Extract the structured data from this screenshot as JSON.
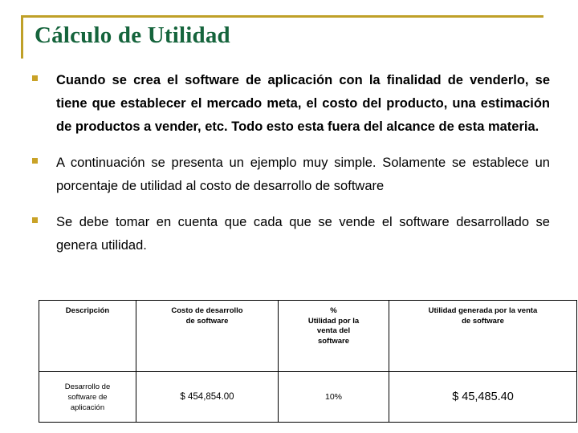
{
  "slide": {
    "title": "Cálculo de Utilidad",
    "accent_color": "#bfa028",
    "title_color": "#15643c",
    "bullet_color": "#c9a227",
    "background": "#ffffff"
  },
  "bullets": [
    {
      "marker": "square-bullet",
      "text": "Cuando se crea el software de aplicación con la finalidad de venderlo, se tiene que establecer el mercado meta, el costo del producto, una estimación de productos a vender, etc.  Todo esto esta fuera del alcance de esta materia.",
      "bold": true
    },
    {
      "marker": "square-bullet",
      "text": "A continuación se presenta un ejemplo muy simple. Solamente se establece un porcentaje de utilidad al costo de desarrollo de software",
      "bold": false
    },
    {
      "marker": "square-bullet",
      "text": "Se debe tomar en cuenta que cada que se vende el software desarrollado se genera utilidad.",
      "bold": false
    }
  ],
  "table": {
    "headers": [
      {
        "lines": [
          "Descripción"
        ]
      },
      {
        "lines": [
          "Costo de desarrollo",
          "de software"
        ]
      },
      {
        "lines": [
          "%",
          "Utilidad por la",
          "venta del",
          "software"
        ]
      },
      {
        "lines": [
          "Utilidad generada por la venta",
          "de software"
        ]
      }
    ],
    "rows": [
      {
        "descripcion_lines": [
          "Desarrollo de",
          "software de",
          "aplicación"
        ],
        "costo_desarrollo": "$ 454,854.00",
        "porcentaje_utilidad": "10%",
        "utilidad_generada": "$ 45,485.40"
      }
    ]
  }
}
